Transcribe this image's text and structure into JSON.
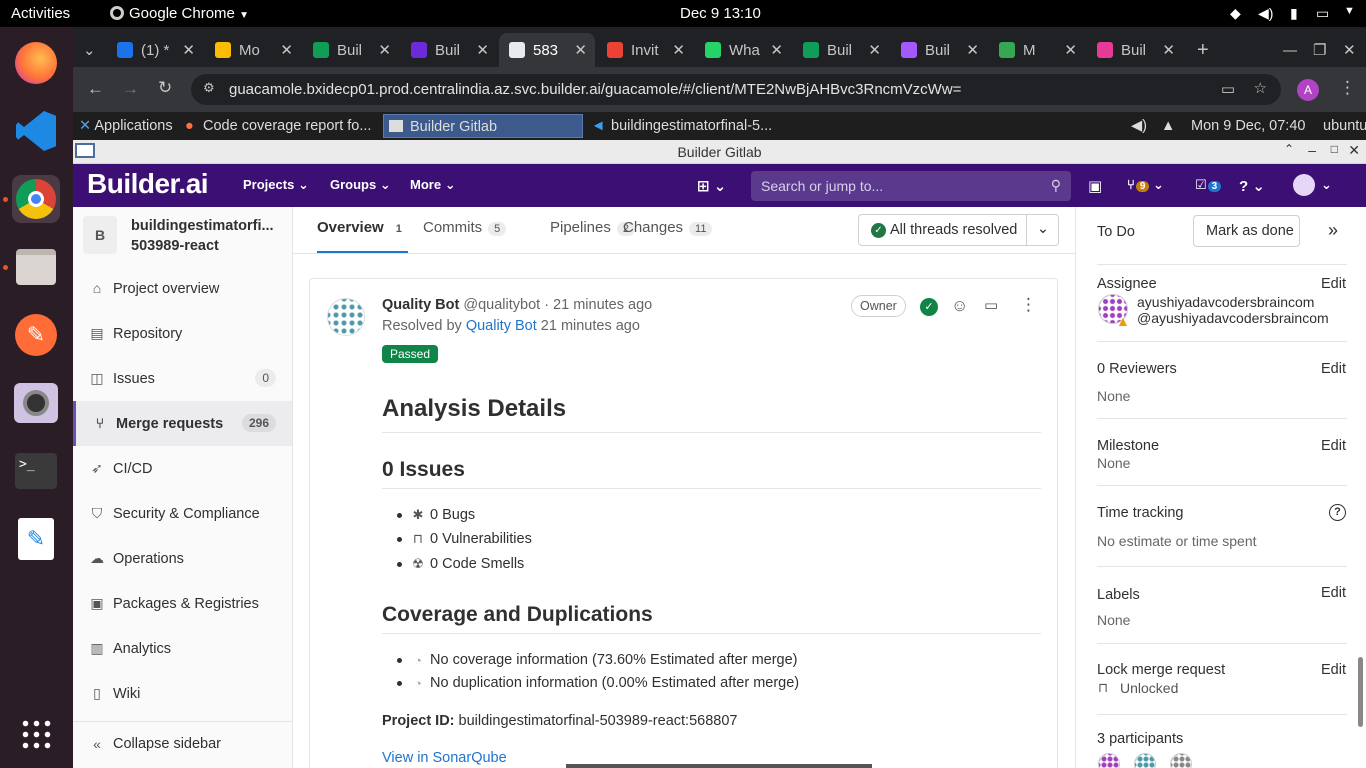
{
  "os": {
    "activities": "Activities",
    "app_menu": "Google Chrome",
    "clock": "Dec 9  13:10"
  },
  "chrome": {
    "tabs": [
      {
        "label": "(1) *",
        "color": "#1a73e8"
      },
      {
        "label": "Mo",
        "color": "#fbbc04"
      },
      {
        "label": "Buil",
        "color": "#0f9d58"
      },
      {
        "label": "Buil",
        "color": "#6c2bd9"
      },
      {
        "label": "583",
        "color": "#e8eaed"
      },
      {
        "label": "Invit",
        "color": "#ea4335"
      },
      {
        "label": "Wha",
        "color": "#25d366"
      },
      {
        "label": "Buil",
        "color": "#0f9d58"
      },
      {
        "label": "Buil",
        "color": "#a259ff"
      },
      {
        "label": "M",
        "color": "#34a853"
      },
      {
        "label": "Buil",
        "color": "#e63b94"
      }
    ],
    "url": "guacamole.bxidecp01.prod.centralindia.az.svc.builder.ai/guacamole/#/client/MTE2NwBjAHBvc3RncmVzcWw=",
    "profile_initial": "A"
  },
  "remote": {
    "applications": "Applications",
    "tasks": [
      "Code coverage report fo...",
      "Builder Gitlab",
      "buildingestimatorfinal-5..."
    ],
    "clock": "Mon  9 Dec, 07:40",
    "user": "ubuntu",
    "window_title": "Builder Gitlab"
  },
  "gitlab": {
    "logo": "Builder.ai",
    "nav": [
      "Projects",
      "Groups",
      "More"
    ],
    "search_placeholder": "Search or jump to...",
    "mr_count": "9",
    "todo_count": "3",
    "project": {
      "avatar": "B",
      "name_line1": "buildingestimatorfi...",
      "name_line2": "503989-react"
    },
    "sidebar": [
      {
        "label": "Project overview",
        "icon": "home-icon"
      },
      {
        "label": "Repository",
        "icon": "book-icon"
      },
      {
        "label": "Issues",
        "icon": "issues-icon",
        "count": "0"
      },
      {
        "label": "Merge requests",
        "icon": "merge-request-icon",
        "count": "296"
      },
      {
        "label": "CI/CD",
        "icon": "rocket-icon"
      },
      {
        "label": "Security & Compliance",
        "icon": "shield-icon"
      },
      {
        "label": "Operations",
        "icon": "cloud-icon"
      },
      {
        "label": "Packages & Registries",
        "icon": "package-icon"
      },
      {
        "label": "Analytics",
        "icon": "chart-icon"
      },
      {
        "label": "Wiki",
        "icon": "wiki-icon"
      }
    ],
    "collapse": "Collapse sidebar",
    "tabs": [
      {
        "label": "Overview",
        "count": "1"
      },
      {
        "label": "Commits",
        "count": "5"
      },
      {
        "label": "Pipelines",
        "count": "2"
      },
      {
        "label": "Changes",
        "count": "11"
      }
    ],
    "threads_resolved": "All threads resolved",
    "note": {
      "author": "Quality Bot",
      "username": "@qualitybot",
      "time": "· 21 minutes ago",
      "resolved_prefix": "Resolved by",
      "resolved_by": "Quality Bot",
      "resolved_time": "21 minutes ago",
      "badge": "Owner",
      "status": "Passed",
      "analysis_title": "Analysis Details",
      "issues_title": "0 Issues",
      "issues": [
        "0 Bugs",
        "0 Vulnerabilities",
        "0 Code Smells"
      ],
      "coverage_title": "Coverage and Duplications",
      "coverage": [
        "No coverage information (73.60% Estimated after merge)",
        "No duplication information (0.00% Estimated after merge)"
      ],
      "project_id_label": "Project ID:",
      "project_id": "buildingestimatorfinal-503989-react:568807",
      "sonar_link": "View in SonarQube"
    },
    "right": {
      "todo": "To Do",
      "mark_done": "Mark as done",
      "assignee_label": "Assignee",
      "edit": "Edit",
      "assignee_name": "ayushiyadavcodersbraincom",
      "assignee_user": "@ayushiyadavcodersbraincom",
      "reviewers_label": "0 Reviewers",
      "reviewers_value": "None",
      "milestone_label": "Milestone",
      "milestone_value": "None",
      "time_label": "Time tracking",
      "time_value": "No estimate or time spent",
      "labels_label": "Labels",
      "labels_value": "None",
      "lock_label": "Lock merge request",
      "lock_value": "Unlocked",
      "participants": "3 participants"
    }
  }
}
